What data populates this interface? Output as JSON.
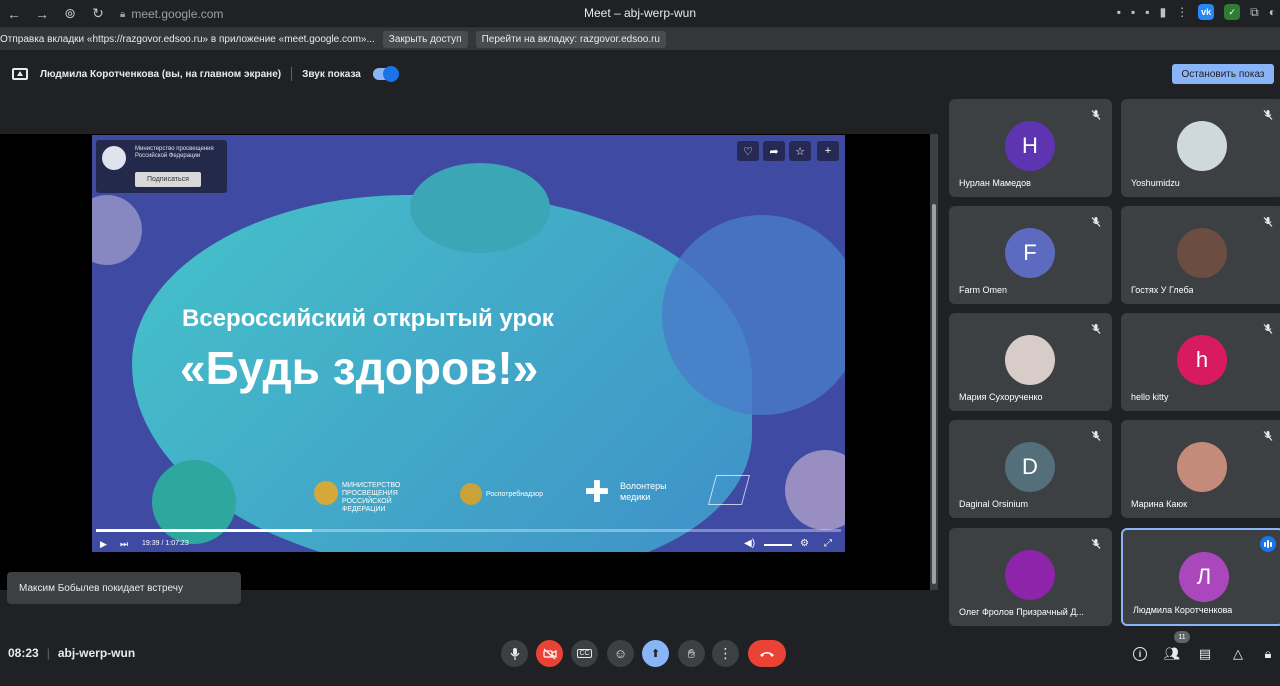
{
  "browser": {
    "url": "meet.google.com",
    "tab_title": "Meet – abj-werp-wun"
  },
  "share_notice": {
    "text": "Отправка вкладки «https://razgovor.edsoo.ru» в приложение «meet.google.com»...",
    "stop_access_label": "Закрыть доступ",
    "go_to_tab_label": "Перейти на вкладку: razgovor.edsoo.ru"
  },
  "presenting": {
    "presenter_text": "Людмила Коротченкова (вы, на главном экране)",
    "audio_label": "Звук показа",
    "audio_on": true,
    "stop_label": "Остановить показ"
  },
  "slide": {
    "ministry_text": "Министерство просвещения Российской Федерации",
    "subscribe_label": "Подписаться",
    "title": "Всероссийский открытый урок",
    "main": "«Будь здоров!»",
    "logo1": "МИНИСТЕРСТВО ПРОСВЕЩЕНИЯ РОССИЙСКОЙ ФЕДЕРАЦИИ",
    "logo2": "Роспотребнадзор",
    "logo3": "Волонтеры медики",
    "time": "19:39 / 1:07:23",
    "progress": 0.29
  },
  "participants": [
    {
      "name": "Нурлан Мамедов",
      "initial": "H",
      "color": "#5e35b1",
      "muted": true
    },
    {
      "name": "Yoshumidzu",
      "initial": "",
      "color": "#cfd8dc",
      "muted": true
    },
    {
      "name": "Farm Omen",
      "initial": "F",
      "color": "#5c6bc0",
      "muted": true
    },
    {
      "name": "Гостях У Глеба",
      "initial": "",
      "color": "#6d4c41",
      "muted": true
    },
    {
      "name": "Мария Сухорученко",
      "initial": "",
      "color": "#d7ccc8",
      "muted": true
    },
    {
      "name": "hello kitty",
      "initial": "h",
      "color": "#d81b60",
      "muted": true
    },
    {
      "name": "Daginal Orsinium",
      "initial": "D",
      "color": "#546e7a",
      "muted": true
    },
    {
      "name": "Марина Каюк",
      "initial": "",
      "color": "#c48b7a",
      "muted": true
    },
    {
      "name": "Олег Фролов Призрачный Д...",
      "initial": "",
      "color": "#8e24aa",
      "muted": true
    },
    {
      "name": "Людмила Коротченкова",
      "initial": "Л",
      "color": "#ab47bc",
      "muted": false
    }
  ],
  "toast": "Максим Бобылев покидает встречу",
  "meeting": {
    "time": "08:23",
    "code": "abj-werp-wun",
    "people_count": "11"
  }
}
